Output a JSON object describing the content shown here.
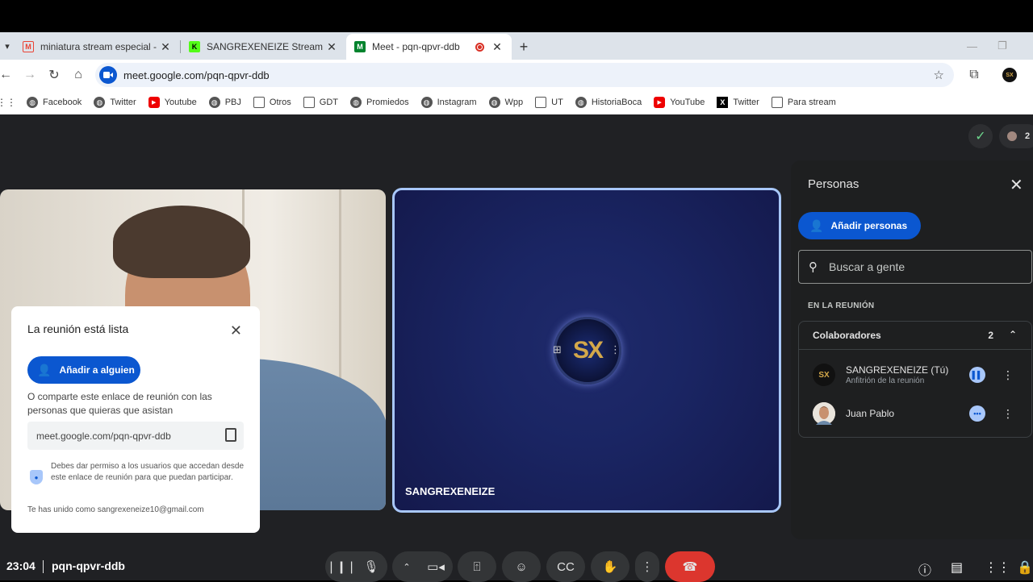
{
  "browser": {
    "tabs": [
      {
        "title": "miniatura stream especial - san",
        "favicon": "M"
      },
      {
        "title": "SANGREXENEIZE Stream - Watc",
        "favicon": "K"
      },
      {
        "title": "Meet - pqn-qpvr-ddb",
        "favicon": "M"
      }
    ],
    "new_tab": "+",
    "url": "meet.google.com/pqn-qpvr-ddb",
    "profile": "SX",
    "bookmarks": [
      "Facebook",
      "Twitter",
      "Youtube",
      "PBJ",
      "Otros",
      "GDT",
      "Promiedos",
      "Instagram",
      "Wpp",
      "UT",
      "HistoriaBoca",
      "YouTube",
      "Twitter",
      "Para stream"
    ]
  },
  "meet": {
    "participant_count": "2",
    "tile_name": "SANGREXENEIZE",
    "avatar_initials": "SX",
    "ready_card": {
      "title": "La reunión está lista",
      "add_button": "Añadir a alguien",
      "description": "O comparte este enlace de reunión con las personas que quieras que asistan",
      "link": "meet.google.com/pqn-qpvr-ddb",
      "note": "Debes dar permiso a los usuarios que accedan desde este enlace de reunión para que puedan participar.",
      "joined": "Te has unido como sangrexeneize10@gmail.com"
    },
    "panel": {
      "title": "Personas",
      "add_people": "Añadir personas",
      "search_placeholder": "Buscar a gente",
      "section": "EN LA REUNIÓN",
      "group_name": "Colaboradores",
      "group_count": "2",
      "people": [
        {
          "name": "SANGREXENEIZE (Tú)",
          "role": "Anfitrión de la reunión",
          "initials": "SX"
        },
        {
          "name": "Juan Pablo",
          "role": ""
        }
      ]
    },
    "bottom": {
      "time": "23:04",
      "code": "pqn-qpvr-ddb"
    }
  }
}
